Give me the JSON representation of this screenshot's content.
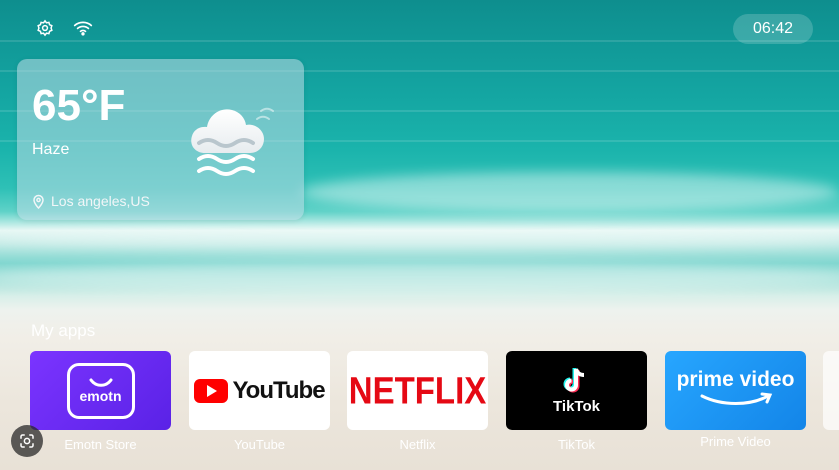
{
  "status_bar": {
    "settings_icon": "gear-icon",
    "wifi_icon": "wifi-icon",
    "time": "06:42"
  },
  "weather": {
    "temperature": "65°F",
    "condition": "Haze",
    "location": "Los angeles,US",
    "condition_icon": "haze-cloud-icon",
    "location_icon": "location-pin-icon"
  },
  "apps_section": {
    "title": "My apps",
    "apps": [
      {
        "label": "Emotn Store",
        "tile_text": "emotn",
        "color": "#6a2cf0"
      },
      {
        "label": "YouTube",
        "tile_text": "YouTube",
        "color": "#ffffff"
      },
      {
        "label": "Netflix",
        "tile_text": "NETFLIX",
        "color": "#ffffff"
      },
      {
        "label": "TikTok",
        "tile_text": "TikTok",
        "color": "#000000"
      },
      {
        "label": "Prime Video",
        "tile_text": "prime video",
        "color": "#1a98ff"
      }
    ]
  },
  "lens_icon": "lens-camera-icon"
}
